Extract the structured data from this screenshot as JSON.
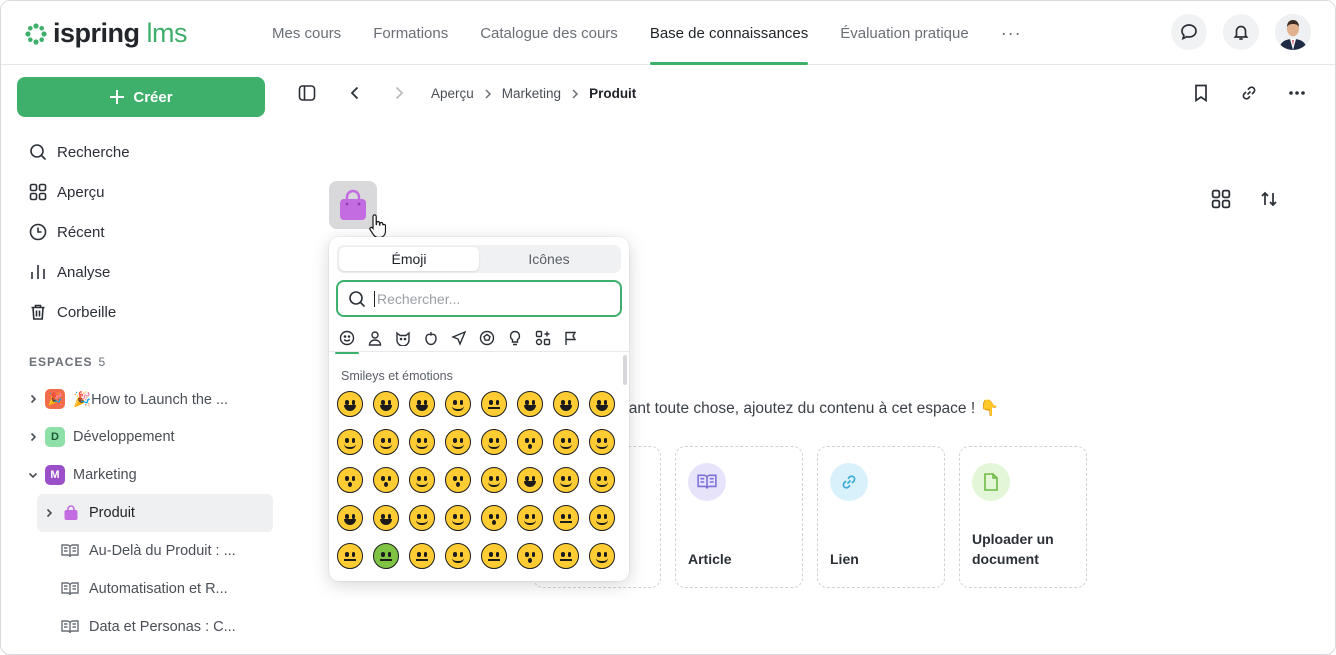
{
  "brand": {
    "name": "ispring",
    "suffix": "lms"
  },
  "nav": {
    "items": [
      "Mes cours",
      "Formations",
      "Catalogue des cours",
      "Base de connaissances",
      "Évaluation pratique"
    ],
    "active": "Base de connaissances",
    "more": "···"
  },
  "sidebar": {
    "create_label": "Créer",
    "menu": [
      {
        "label": "Recherche",
        "icon": "search-icon"
      },
      {
        "label": "Aperçu",
        "icon": "grid-icon"
      },
      {
        "label": "Récent",
        "icon": "clock-icon"
      },
      {
        "label": "Analyse",
        "icon": "bar-chart-icon"
      },
      {
        "label": "Corbeille",
        "icon": "trash-icon"
      }
    ],
    "spaces_title": "ESPACES",
    "spaces_count": "5",
    "spaces": [
      {
        "label": "How to Launch the ...",
        "badge": "🎉",
        "badge_color": "#f26b4a"
      },
      {
        "label": "Développement",
        "badge": "D",
        "badge_color": "#8fe0a8"
      },
      {
        "label": "Marketing",
        "badge": "M",
        "badge_color": "#9b4fc8"
      }
    ],
    "selected": {
      "label": "Produit"
    },
    "pages": [
      {
        "label": "Au-Delà du Produit : ..."
      },
      {
        "label": "Automatisation et R..."
      },
      {
        "label": "Data et Personas : C..."
      }
    ]
  },
  "breadcrumb": {
    "items": [
      "Aperçu",
      "Marketing"
    ],
    "current": "Produit"
  },
  "main": {
    "empty_text": "vant toute chose, ajoutez du contenu à cet espace ! 👇",
    "cards": [
      {
        "label": "Article",
        "icon": "book-icon",
        "color": "#e7e3fb"
      },
      {
        "label": "Lien",
        "icon": "link-icon",
        "color": "#d9f1fb"
      },
      {
        "label": "Uploader un document",
        "icon": "file-icon",
        "color": "#e3f6d8"
      }
    ]
  },
  "picker": {
    "tabs": [
      "Émoji",
      "Icônes"
    ],
    "active_tab": "Émoji",
    "search_placeholder": "Rechercher...",
    "section_label": "Smileys et émotions"
  },
  "colors": {
    "accent": "#3eb06b",
    "marketing": "#9b4fc8",
    "bag": "#c36be0"
  }
}
